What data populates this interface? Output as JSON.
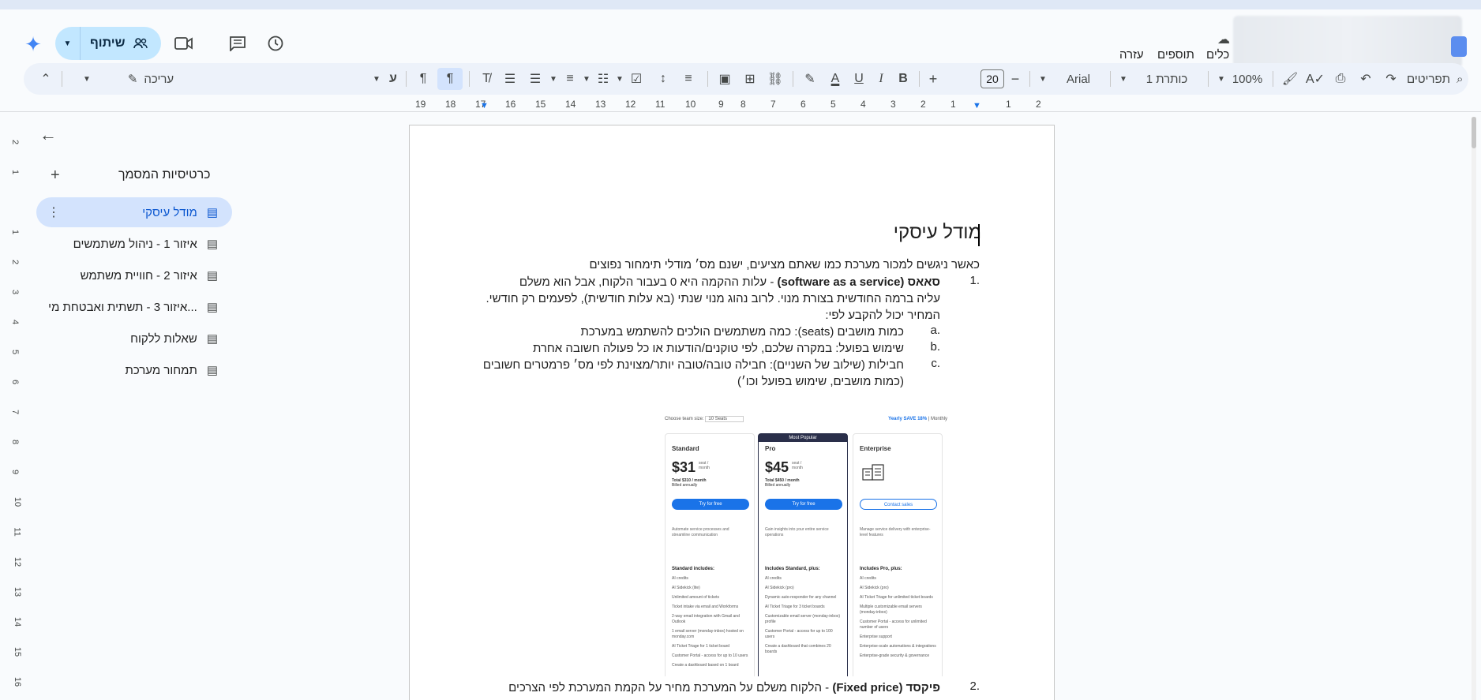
{
  "topbar": {
    "share_label": "שיתוף",
    "menus": [
      "עזרה",
      "תוספים",
      "כלים"
    ]
  },
  "toolbar": {
    "search_label": "תפריטים",
    "zoom": "100%",
    "style": "כותרת 1",
    "font": "Arial",
    "font_size": "20",
    "editing_mode": "עריכה"
  },
  "ruler": {
    "horizontal": [
      "19",
      "18",
      "17",
      "16",
      "15",
      "14",
      "13",
      "12",
      "11",
      "10",
      "9",
      "8",
      "7",
      "6",
      "5",
      "4",
      "3",
      "2",
      "1",
      "1",
      "2"
    ],
    "vertical": [
      "2",
      "1",
      "1",
      "2",
      "3",
      "4",
      "5",
      "6",
      "7",
      "8",
      "9",
      "10",
      "11",
      "12",
      "13",
      "14",
      "15",
      "16"
    ]
  },
  "sidebar": {
    "title": "כרטיסיות המסמך",
    "tabs": [
      {
        "label": "מודל עיסקי",
        "active": true
      },
      {
        "label": "איזור 1 - ניהול משתמשים",
        "active": false
      },
      {
        "label": "איזור 2 - חוויית משתמש",
        "active": false
      },
      {
        "label": "איזור 3 - תשתית ואבטחת מי...",
        "active": false
      },
      {
        "label": "שאלות ללקוח",
        "active": false
      },
      {
        "label": "תמחור מערכת",
        "active": false
      }
    ]
  },
  "document": {
    "title": "מודל עיסקי",
    "intro": "כאשר ניגשים למכור מערכת כמו שאתם מציעים, ישנם מס׳ מודלי תימחור נפוצים",
    "item1_num": "1.",
    "item1_bold": "סאאס  (software as a service)",
    "item1_rest": " - עלות ההקמה היא 0 בעבור הלקוח, אבל הוא משלם",
    "item1_line2": "עליה ברמה החודשית בצורת מנוי. לרוב נהוג מנוי שנתי (בא עלות חודשית), לפעמים רק חודשי.",
    "item1_line3": "המחיר יכול להקבע לפי:",
    "subitems": [
      {
        "num": "a.",
        "text": "כמות מושבים (seats): כמה משתמשים הולכים להשתמש במערכת"
      },
      {
        "num": "b.",
        "text": "שימוש בפועל: במקרה שלכם, לפי טוקנים/הודעות או כל פעולה חשובה אחרת"
      },
      {
        "num": "c.",
        "text": "חבילות (שילוב של השניים): חבילה טובה/טובה יותר/מצוינת לפי מס׳ פרמטרים חשובים"
      }
    ],
    "subitem_c_line2": "(כמות מושבים, שימוש בפועל וכו׳)",
    "item2_num": "2.",
    "item2_bold": "פיקסד (Fixed price)",
    "item2_rest": " - הלקוח משלם על המערכת מחיר על הקמת המערכת לפי הצרכים"
  },
  "pricing_image": {
    "team_size_label": "Choose team size:",
    "team_size_value": "10 Seats",
    "billing": "Yearly SAVE 18%",
    "billing_alt": "Monthly",
    "plans": [
      {
        "name": "Standard",
        "price": "$31",
        "per": "seat / month",
        "total": "Total $310 / month",
        "billed": "Billed annually",
        "button": "Try for free",
        "desc": "Automate service processes and streamline communication",
        "includes": "Standard includes:",
        "features": [
          "AI credits",
          "AI Sidekick (lite)",
          "Unlimited amount of tickets",
          "Ticket intake via email and Workforms",
          "2-way email integration with Gmail and Outlook",
          "1 email server (monday-inbox) hosted on monday.com",
          "AI Ticket Triage for 1 ticket board",
          "Customer Portal - access for up to 10 users",
          "Create a dashboard based on 1 board"
        ]
      },
      {
        "name": "Pro",
        "badge": "Most Popular",
        "price": "$45",
        "per": "seat / month",
        "total": "Total $450 / month",
        "billed": "Billed annually",
        "button": "Try for free",
        "desc": "Gain insights into your entire service operations",
        "includes": "Includes Standard, plus:",
        "features": [
          "AI credits",
          "AI Sidekick (pro)",
          "Dynamic auto-responder for any channel",
          "AI Ticket Triage for 3 ticket boards",
          "Customizable email server (monday-inbox) profile",
          "Customer Portal - access for up to 100 users",
          "Create a dashboard that combines 20 boards"
        ]
      },
      {
        "name": "Enterprise",
        "button": "Contact sales",
        "desc": "Manage service delivery with enterprise-level features",
        "includes": "Includes Pro, plus:",
        "features": [
          "AI credits",
          "AI Sidekick (pro)",
          "AI Ticket Triage for unlimited ticket boards",
          "Multiple customizable email servers (monday-inbox)",
          "Customer Portal - access for unlimited number of users",
          "Enterprise support",
          "Enterprise-scale automations & integrations",
          "Enterprise-grade security & governance"
        ]
      }
    ]
  }
}
